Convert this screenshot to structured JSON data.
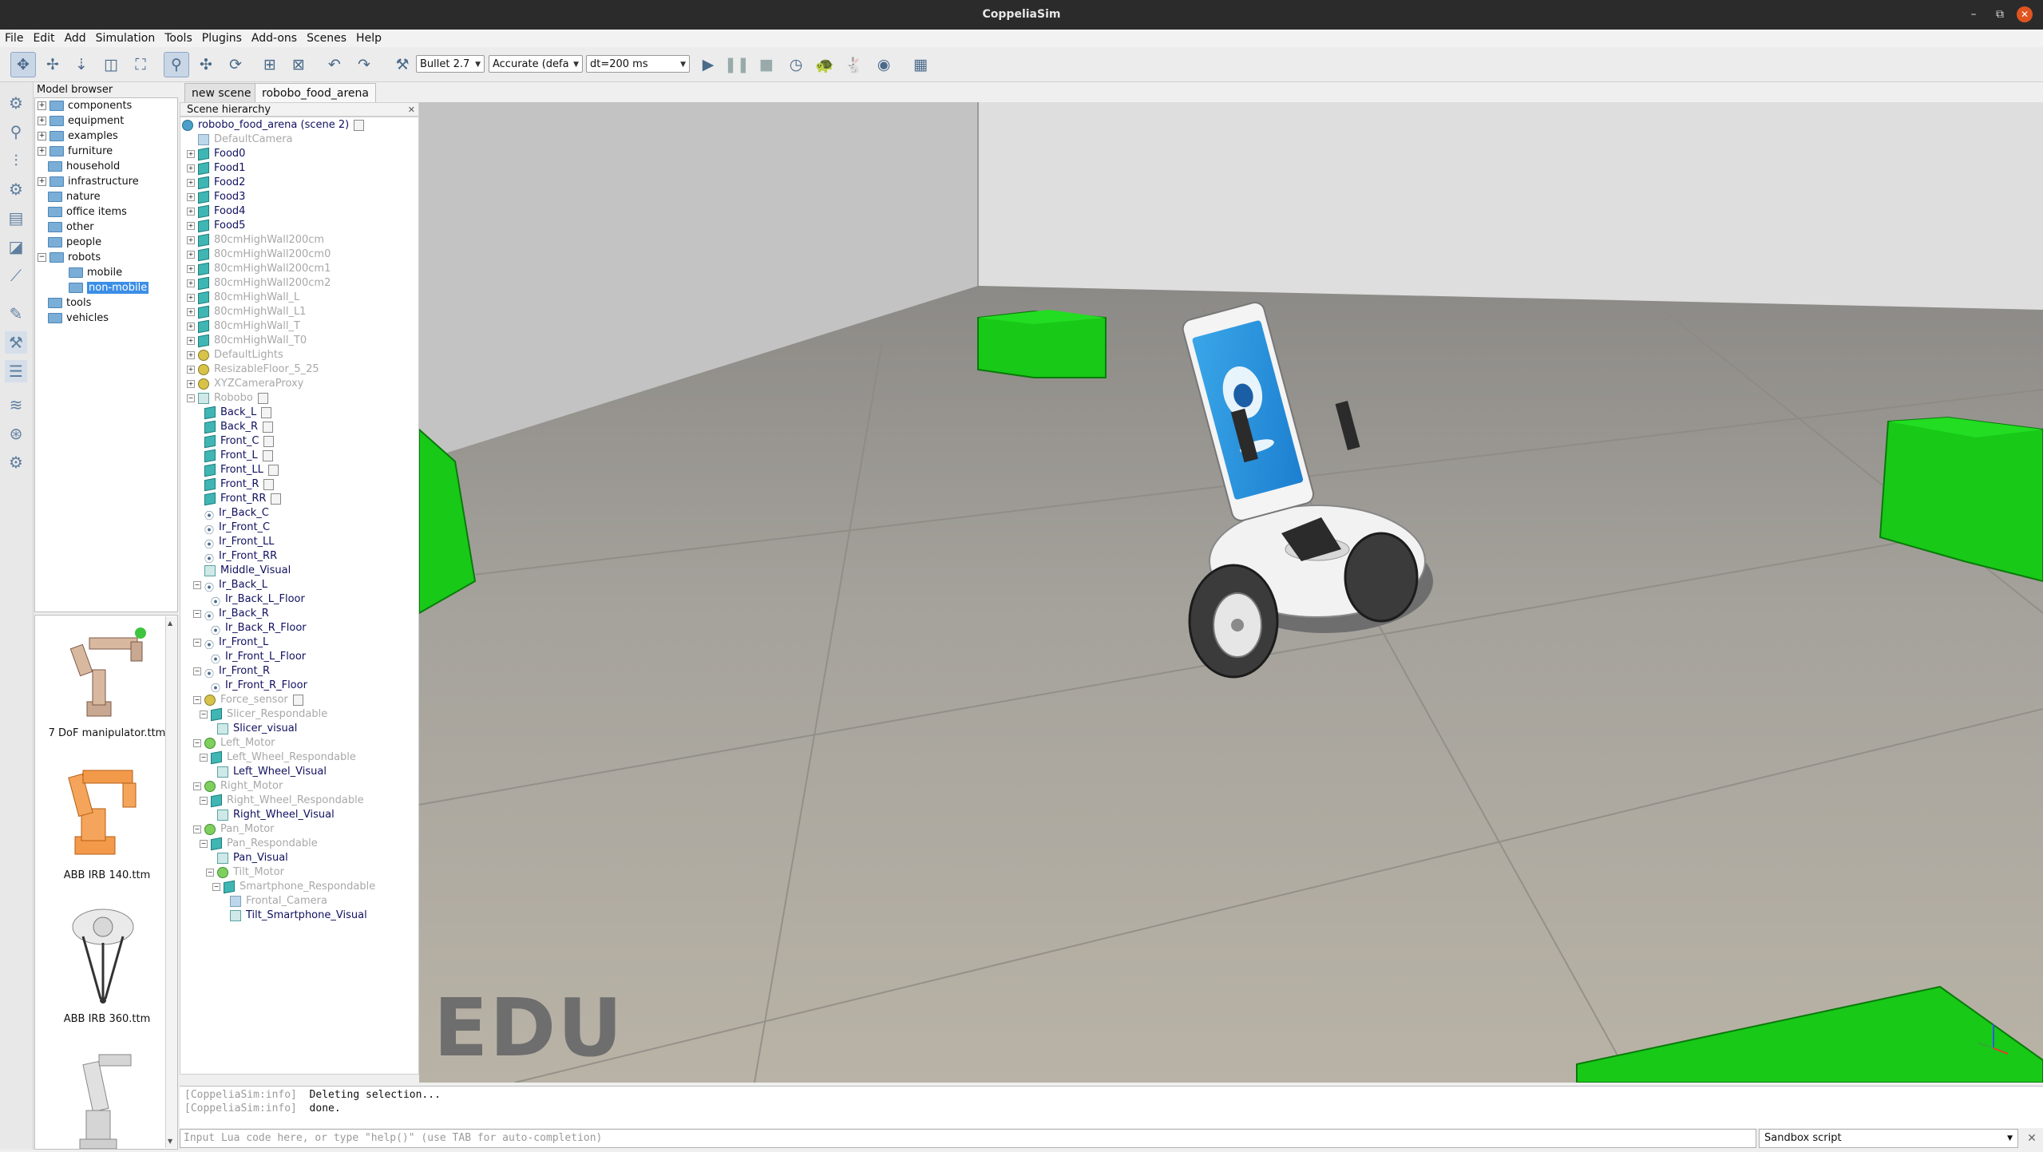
{
  "window": {
    "title": "CoppeliaSim",
    "minimize": "–",
    "restore": "⧉",
    "close": "✕"
  },
  "menu": [
    "File",
    "Edit",
    "Add",
    "Simulation",
    "Tools",
    "Plugins",
    "Add-ons",
    "Scenes",
    "Help"
  ],
  "toolbar": {
    "engine": "Bullet 2.7",
    "accuracy": "Accurate (defa",
    "dt": "dt=200 ms"
  },
  "model_browser": {
    "title": "Model browser",
    "folders": [
      {
        "label": "components",
        "level": 0,
        "expand": "+"
      },
      {
        "label": "equipment",
        "level": 0,
        "expand": "+"
      },
      {
        "label": "examples",
        "level": 0,
        "expand": "+"
      },
      {
        "label": "furniture",
        "level": 0,
        "expand": "+"
      },
      {
        "label": "household",
        "level": 0,
        "expand": ""
      },
      {
        "label": "infrastructure",
        "level": 0,
        "expand": "+"
      },
      {
        "label": "nature",
        "level": 0,
        "expand": ""
      },
      {
        "label": "office items",
        "level": 0,
        "expand": ""
      },
      {
        "label": "other",
        "level": 0,
        "expand": ""
      },
      {
        "label": "people",
        "level": 0,
        "expand": ""
      },
      {
        "label": "robots",
        "level": 0,
        "expand": "−"
      },
      {
        "label": "mobile",
        "level": 1,
        "expand": ""
      },
      {
        "label": "non-mobile",
        "level": 1,
        "expand": "",
        "selected": true
      },
      {
        "label": "tools",
        "level": 0,
        "expand": ""
      },
      {
        "label": "vehicles",
        "level": 0,
        "expand": ""
      }
    ],
    "thumbnails": [
      "7 DoF manipulator.ttm",
      "ABB IRB 140.ttm",
      "ABB IRB 360.ttm",
      ""
    ]
  },
  "tabs": [
    {
      "label": "new scene",
      "active": false
    },
    {
      "label": "robobo_food_arena",
      "active": true
    }
  ],
  "hierarchy": {
    "title": "Scene hierarchy",
    "close": "✕",
    "items": [
      {
        "label": "robobo_food_arena (scene 2)",
        "level": 0,
        "type": "scene",
        "style": "norm",
        "toggle": "",
        "script": true
      },
      {
        "label": "DefaultCamera",
        "level": 1,
        "type": "camera",
        "style": "dim",
        "toggle": ""
      },
      {
        "label": "Food0",
        "level": 1,
        "type": "shape",
        "style": "norm",
        "toggle": "+"
      },
      {
        "label": "Food1",
        "level": 1,
        "type": "shape",
        "style": "norm",
        "toggle": "+"
      },
      {
        "label": "Food2",
        "level": 1,
        "type": "shape",
        "style": "norm",
        "toggle": "+"
      },
      {
        "label": "Food3",
        "level": 1,
        "type": "shape",
        "style": "norm",
        "toggle": "+"
      },
      {
        "label": "Food4",
        "level": 1,
        "type": "shape",
        "style": "norm",
        "toggle": "+"
      },
      {
        "label": "Food5",
        "level": 1,
        "type": "shape",
        "style": "norm",
        "toggle": "+"
      },
      {
        "label": "80cmHighWall200cm",
        "level": 1,
        "type": "shape",
        "style": "dim",
        "toggle": "+"
      },
      {
        "label": "80cmHighWall200cm0",
        "level": 1,
        "type": "shape",
        "style": "dim",
        "toggle": "+"
      },
      {
        "label": "80cmHighWall200cm1",
        "level": 1,
        "type": "shape",
        "style": "dim",
        "toggle": "+"
      },
      {
        "label": "80cmHighWall200cm2",
        "level": 1,
        "type": "shape",
        "style": "dim",
        "toggle": "+"
      },
      {
        "label": "80cmHighWall_L",
        "level": 1,
        "type": "shape",
        "style": "dim",
        "toggle": "+"
      },
      {
        "label": "80cmHighWall_L1",
        "level": 1,
        "type": "shape",
        "style": "dim",
        "toggle": "+"
      },
      {
        "label": "80cmHighWall_T",
        "level": 1,
        "type": "shape",
        "style": "dim",
        "toggle": "+"
      },
      {
        "label": "80cmHighWall_T0",
        "level": 1,
        "type": "shape",
        "style": "dim",
        "toggle": "+"
      },
      {
        "label": "DefaultLights",
        "level": 1,
        "type": "light",
        "style": "dim",
        "toggle": "+"
      },
      {
        "label": "ResizableFloor_5_25",
        "level": 1,
        "type": "light",
        "style": "dim",
        "toggle": "+"
      },
      {
        "label": "XYZCameraProxy",
        "level": 1,
        "type": "light",
        "style": "dim",
        "toggle": "+"
      },
      {
        "label": "Robobo",
        "level": 1,
        "type": "visual",
        "style": "dim",
        "toggle": "−",
        "script": true
      },
      {
        "label": "Back_L",
        "level": 2,
        "type": "shape",
        "style": "norm",
        "toggle": "",
        "script": true
      },
      {
        "label": "Back_R",
        "level": 2,
        "type": "shape",
        "style": "norm",
        "toggle": "",
        "script": true
      },
      {
        "label": "Front_C",
        "level": 2,
        "type": "shape",
        "style": "norm",
        "toggle": "",
        "script": true
      },
      {
        "label": "Front_L",
        "level": 2,
        "type": "shape",
        "style": "norm",
        "toggle": "",
        "script": true
      },
      {
        "label": "Front_LL",
        "level": 2,
        "type": "shape",
        "style": "norm",
        "toggle": "",
        "script": true
      },
      {
        "label": "Front_R",
        "level": 2,
        "type": "shape",
        "style": "norm",
        "toggle": "",
        "script": true
      },
      {
        "label": "Front_RR",
        "level": 2,
        "type": "shape",
        "style": "norm",
        "toggle": "",
        "script": true
      },
      {
        "label": "Ir_Back_C",
        "level": 2,
        "type": "sensor",
        "style": "norm",
        "toggle": ""
      },
      {
        "label": "Ir_Front_C",
        "level": 2,
        "type": "sensor",
        "style": "norm",
        "toggle": ""
      },
      {
        "label": "Ir_Front_LL",
        "level": 2,
        "type": "sensor",
        "style": "norm",
        "toggle": ""
      },
      {
        "label": "Ir_Front_RR",
        "level": 2,
        "type": "sensor",
        "style": "norm",
        "toggle": ""
      },
      {
        "label": "Middle_Visual",
        "level": 2,
        "type": "visual",
        "style": "norm",
        "toggle": ""
      },
      {
        "label": "Ir_Back_L",
        "level": 2,
        "type": "sensor",
        "style": "norm",
        "toggle": "−"
      },
      {
        "label": "Ir_Back_L_Floor",
        "level": 3,
        "type": "sensor",
        "style": "norm",
        "toggle": ""
      },
      {
        "label": "Ir_Back_R",
        "level": 2,
        "type": "sensor",
        "style": "norm",
        "toggle": "−"
      },
      {
        "label": "Ir_Back_R_Floor",
        "level": 3,
        "type": "sensor",
        "style": "norm",
        "toggle": ""
      },
      {
        "label": "Ir_Front_L",
        "level": 2,
        "type": "sensor",
        "style": "norm",
        "toggle": "−"
      },
      {
        "label": "Ir_Front_L_Floor",
        "level": 3,
        "type": "sensor",
        "style": "norm",
        "toggle": ""
      },
      {
        "label": "Ir_Front_R",
        "level": 2,
        "type": "sensor",
        "style": "norm",
        "toggle": "−"
      },
      {
        "label": "Ir_Front_R_Floor",
        "level": 3,
        "type": "sensor",
        "style": "norm",
        "toggle": ""
      },
      {
        "label": "Force_sensor",
        "level": 2,
        "type": "light",
        "style": "dim",
        "toggle": "−",
        "script": true
      },
      {
        "label": "Slicer_Respondable",
        "level": 3,
        "type": "shape",
        "style": "dim",
        "toggle": "−"
      },
      {
        "label": "Slicer_visual",
        "level": 4,
        "type": "visual",
        "style": "norm",
        "toggle": ""
      },
      {
        "label": "Left_Motor",
        "level": 2,
        "type": "motor",
        "style": "dim",
        "toggle": "−"
      },
      {
        "label": "Left_Wheel_Respondable",
        "level": 3,
        "type": "shape",
        "style": "dim",
        "toggle": "−"
      },
      {
        "label": "Left_Wheel_Visual",
        "level": 4,
        "type": "visual",
        "style": "norm",
        "toggle": ""
      },
      {
        "label": "Right_Motor",
        "level": 2,
        "type": "motor",
        "style": "dim",
        "toggle": "−"
      },
      {
        "label": "Right_Wheel_Respondable",
        "level": 3,
        "type": "shape",
        "style": "dim",
        "toggle": "−"
      },
      {
        "label": "Right_Wheel_Visual",
        "level": 4,
        "type": "visual",
        "style": "norm",
        "toggle": ""
      },
      {
        "label": "Pan_Motor",
        "level": 2,
        "type": "motor",
        "style": "dim",
        "toggle": "−"
      },
      {
        "label": "Pan_Respondable",
        "level": 3,
        "type": "shape",
        "style": "dim",
        "toggle": "−"
      },
      {
        "label": "Pan_Visual",
        "level": 4,
        "type": "visual",
        "style": "norm",
        "toggle": ""
      },
      {
        "label": "Tilt_Motor",
        "level": 4,
        "type": "motor",
        "style": "dim",
        "toggle": "−"
      },
      {
        "label": "Smartphone_Respondable",
        "level": 5,
        "type": "shape",
        "style": "dim",
        "toggle": "−"
      },
      {
        "label": "Frontal_Camera",
        "level": 6,
        "type": "camera",
        "style": "dim",
        "toggle": ""
      },
      {
        "label": "Tilt_Smartphone_Visual",
        "level": 6,
        "type": "visual",
        "style": "norm",
        "toggle": ""
      }
    ]
  },
  "viewport": {
    "watermark": "EDU",
    "floor_color": "#a8a39a",
    "wall_color": "#cfcfcf",
    "food_color": "#19d419"
  },
  "console": {
    "lines": [
      {
        "tag": "[CoppeliaSim:info]",
        "text": "Deleting selection..."
      },
      {
        "tag": "[CoppeliaSim:info]",
        "text": "done."
      }
    ],
    "input_placeholder": "Input Lua code here, or type \"help()\" (use TAB for auto-completion)",
    "script_selector": "Sandbox script",
    "close": "✕"
  }
}
